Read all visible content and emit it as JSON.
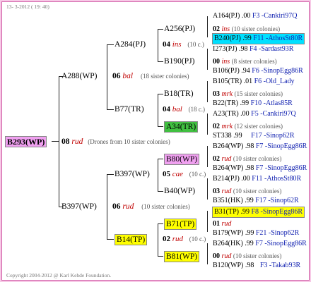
{
  "date_text": "13- 3-2012 ( 19: 40)",
  "footer": "Copyright 2004-2012 @ Karl Kehde Foundation.",
  "colors": {
    "magenta": "#f0a0f0",
    "cyan": "#00e0ff",
    "green": "#40c040",
    "yellow": "#ffff00",
    "pink_border": "#d060a8"
  },
  "root": {
    "name": "B293(WP)",
    "gen": "08",
    "breeder": "rud",
    "note": "(Drones from 10 sister colonies)"
  },
  "gen1": [
    {
      "name": "A288(WP)",
      "gen": "06",
      "breeder": "bal",
      "note": "(18 sister colonies)"
    },
    {
      "name": "B397(WP)",
      "gen": "06",
      "breeder": "rud",
      "note": "(10 sister colonies)"
    }
  ],
  "gen2": [
    {
      "name": "A284(PJ)",
      "gen": "04",
      "breeder": "ins",
      "note": "(10 c.)"
    },
    {
      "name": "B77(TR)",
      "gen": "04",
      "breeder": "bal",
      "note": "(18 c.)"
    },
    {
      "name": "B397(WP)",
      "gen": "05",
      "breeder": "cae",
      "note": "(10 c.)"
    },
    {
      "name": "B14(TP)",
      "gen": "02",
      "breeder": "rud",
      "note": "(10 c.)"
    }
  ],
  "gen3": [
    {
      "name": "A256(PJ)"
    },
    {
      "name": "B190(PJ)"
    },
    {
      "name": "B18(TR)"
    },
    {
      "name": "A34(TR)"
    },
    {
      "name": "B80(WP)"
    },
    {
      "name": "B40(WP)"
    },
    {
      "name": "B71(TP)"
    },
    {
      "name": "B81(WP)"
    }
  ],
  "gen4": [
    {
      "top": "A164(PJ) .00",
      "top_tag": "F3 -Cankiri97Q",
      "mid_gen": "02",
      "mid_breeder": "ins",
      "mid_note": "(10 sister colonies)",
      "bot": "B240(PJ) .99",
      "bot_tag": "F11 -AthosSt80R"
    },
    {
      "top": "I273(PJ) .98",
      "top_tag": "F4 -Sardast93R",
      "mid_gen": "00",
      "mid_breeder": "ins",
      "mid_note": "(8 sister colonies)",
      "bot": "B106(PJ) .94",
      "bot_tag": "F6 -SinopEgg86R"
    },
    {
      "top": "B105(TR) .01",
      "top_tag": "F6 -Old_Lady",
      "mid_gen": "03",
      "mid_breeder": "mrk",
      "mid_note": "(15 sister colonies)",
      "bot": "B22(TR) .99",
      "bot_tag": "F10 -Atlas85R"
    },
    {
      "top": "A23(TR) .00",
      "top_tag": "F5 -Cankiri97Q",
      "mid_gen": "02",
      "mid_breeder": "mrk",
      "mid_note": "(12 sister colonies)",
      "bot": "ST338 .99",
      "bot_tag": "F17 -Sinop62R"
    },
    {
      "top": "B264(WP) .98",
      "top_tag": "F7 -SinopEgg86R",
      "mid_gen": "02",
      "mid_breeder": "rud",
      "mid_note": "(10 sister colonies)",
      "bot": "B264(WP) .98",
      "bot_tag": "F7 -SinopEgg86R"
    },
    {
      "top": "B214(PJ) .00",
      "top_tag": "F11 -AthosSt80R",
      "mid_gen": "03",
      "mid_breeder": "rud",
      "mid_note": "(10 sister colonies)",
      "bot": "B351(HK) .99",
      "bot_tag": "F17 -Sinop62R"
    },
    {
      "top": "B31(TP) .99",
      "top_tag": "F8 -SinopEgg86R",
      "mid_gen": "01",
      "mid_breeder": "rud",
      "mid_note": "",
      "bot": "B179(WP) .99",
      "bot_tag": "F21 -Sinop62R"
    },
    {
      "top": "B264(HK) .99",
      "top_tag": "F7 -SinopEgg86R",
      "mid_gen": "00",
      "mid_breeder": "rud",
      "mid_note": "(10 sister colonies)",
      "bot": "B120(WP) .98",
      "bot_tag": "F3 -Takab93R"
    }
  ]
}
